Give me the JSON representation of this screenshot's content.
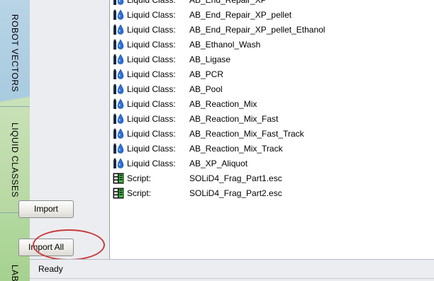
{
  "side_tabs": {
    "robot_vectors": "ROBOT VECTORS",
    "liquid_classes": "LIQUID CLASSES",
    "lab": "LAB"
  },
  "buttons": {
    "import": "Import",
    "import_all": "Import All"
  },
  "list": {
    "items": [
      {
        "type": "Liquid Class:",
        "name": "AB_End_Repair_XP",
        "icon": "liquid-class-icon"
      },
      {
        "type": "Liquid Class:",
        "name": "AB_End_Repair_XP_pellet",
        "icon": "liquid-class-icon"
      },
      {
        "type": "Liquid Class:",
        "name": "AB_End_Repair_XP_pellet_Ethanol",
        "icon": "liquid-class-icon"
      },
      {
        "type": "Liquid Class:",
        "name": "AB_Ethanol_Wash",
        "icon": "liquid-class-icon"
      },
      {
        "type": "Liquid Class:",
        "name": "AB_Ligase",
        "icon": "liquid-class-icon"
      },
      {
        "type": "Liquid Class:",
        "name": "AB_PCR",
        "icon": "liquid-class-icon"
      },
      {
        "type": "Liquid Class:",
        "name": "AB_Pool",
        "icon": "liquid-class-icon"
      },
      {
        "type": "Liquid Class:",
        "name": "AB_Reaction_Mix",
        "icon": "liquid-class-icon"
      },
      {
        "type": "Liquid Class:",
        "name": "AB_Reaction_Mix_Fast",
        "icon": "liquid-class-icon"
      },
      {
        "type": "Liquid Class:",
        "name": "AB_Reaction_Mix_Fast_Track",
        "icon": "liquid-class-icon"
      },
      {
        "type": "Liquid Class:",
        "name": "AB_Reaction_Mix_Track",
        "icon": "liquid-class-icon"
      },
      {
        "type": "Liquid Class:",
        "name": "AB_XP_Aliquot",
        "icon": "liquid-class-icon"
      },
      {
        "type": "Script:",
        "name": "SOLiD4_Frag_Part1.esc",
        "icon": "script-icon"
      },
      {
        "type": "Script:",
        "name": "SOLiD4_Frag_Part2.esc",
        "icon": "script-icon"
      }
    ]
  },
  "status": {
    "text": "Ready"
  },
  "colors": {
    "highlight": "#c83a3a",
    "tab_robot": "#a8cadf",
    "tab_liquid": "#b7d8a2"
  }
}
